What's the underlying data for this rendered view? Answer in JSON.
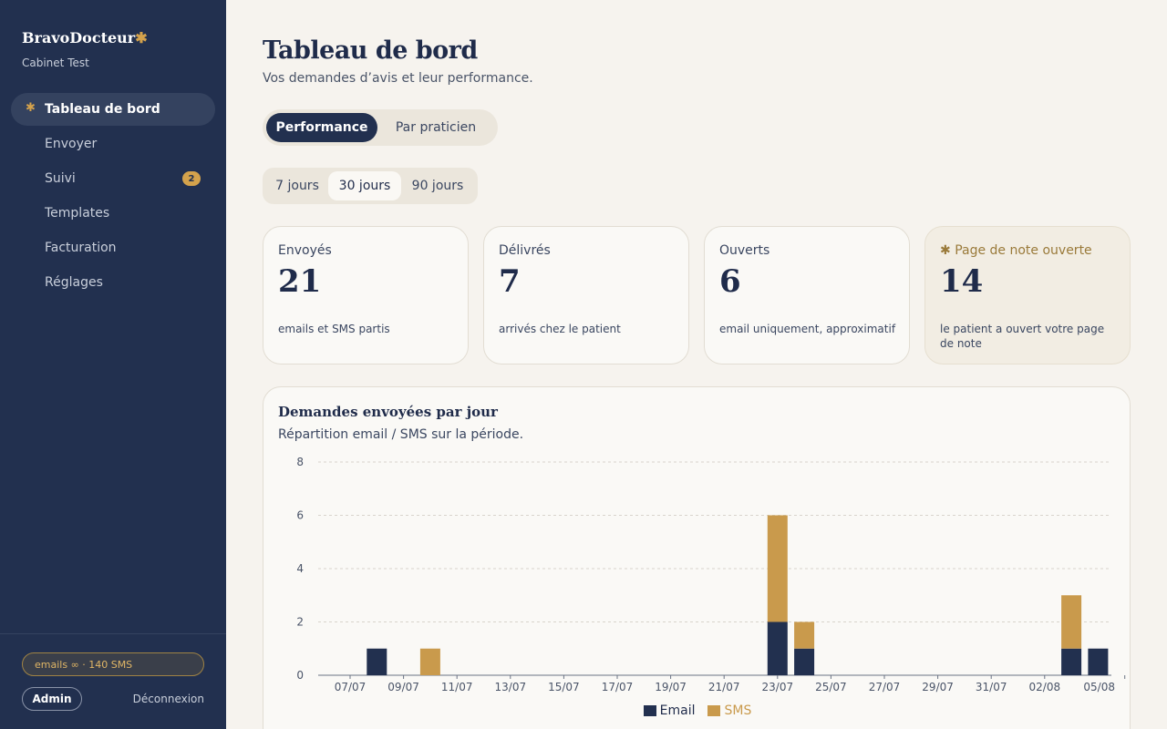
{
  "sidebar": {
    "brand": "BravoDocteur",
    "brand_mark": "✱",
    "cabinet": "Cabinet Test",
    "items": [
      {
        "label": "Tableau de bord",
        "icon": "asterisk-icon",
        "active": true
      },
      {
        "label": "Envoyer"
      },
      {
        "label": "Suivi",
        "badge": "2"
      },
      {
        "label": "Templates"
      },
      {
        "label": "Facturation"
      },
      {
        "label": "Réglages"
      }
    ],
    "quota": "emails ∞ · 140 SMS",
    "admin": "Admin",
    "logout": "Déconnexion"
  },
  "header": {
    "title": "Tableau de bord",
    "subtitle": "Vos demandes d’avis et leur performance."
  },
  "view_tabs": [
    "Performance",
    "Par praticien"
  ],
  "view_selected": "Performance",
  "period_tabs": [
    "7 jours",
    "30 jours",
    "90 jours"
  ],
  "period_selected": "30 jours",
  "kpis": [
    {
      "label": "Envoyés",
      "value": "21",
      "desc": "emails et SMS partis"
    },
    {
      "label": "Délivrés",
      "value": "7",
      "desc": "arrivés chez le patient"
    },
    {
      "label": "Ouverts",
      "value": "6",
      "desc": "email uniquement, approximatif"
    },
    {
      "label": "Page de note ouverte",
      "label_icon": "✱",
      "value": "14",
      "desc": "le patient a ouvert votre page de note",
      "highlight": true
    }
  ],
  "chart": {
    "title": "Demandes envoyées par jour",
    "subtitle": "Répartition email / SMS sur la période."
  },
  "colors": {
    "navy": "#22304f",
    "gold": "#c99a4c",
    "background": "#f6f3ee"
  },
  "chart_data": {
    "type": "bar",
    "stacked": true,
    "categories": [
      "07/07",
      "08/07",
      "09/07",
      "10/07",
      "11/07",
      "12/07",
      "13/07",
      "14/07",
      "15/07",
      "16/07",
      "17/07",
      "18/07",
      "19/07",
      "20/07",
      "21/07",
      "22/07",
      "23/07",
      "24/07",
      "25/07",
      "26/07",
      "27/07",
      "28/07",
      "29/07",
      "30/07",
      "31/07",
      "01/08",
      "02/08",
      "03/08",
      "04/08",
      "05/08"
    ],
    "tick_labels": [
      "07/07",
      "09/07",
      "11/07",
      "13/07",
      "15/07",
      "17/07",
      "19/07",
      "21/07",
      "23/07",
      "25/07",
      "27/07",
      "29/07",
      "31/07",
      "02/08",
      "05/08"
    ],
    "series": [
      {
        "name": "Email",
        "color": "#22304f",
        "values": [
          0,
          1,
          0,
          0,
          0,
          0,
          0,
          0,
          0,
          0,
          0,
          0,
          0,
          0,
          0,
          0,
          2,
          1,
          0,
          0,
          0,
          0,
          0,
          0,
          0,
          0,
          0,
          1,
          1,
          0
        ]
      },
      {
        "name": "SMS",
        "color": "#c99a4c",
        "values": [
          0,
          0,
          0,
          1,
          0,
          0,
          0,
          0,
          0,
          0,
          0,
          0,
          0,
          0,
          0,
          0,
          4,
          1,
          0,
          0,
          0,
          0,
          0,
          0,
          0,
          0,
          0,
          2,
          0,
          0
        ]
      }
    ],
    "yticks": [
      0,
      2,
      4,
      6,
      8
    ],
    "ylim": [
      0,
      8
    ],
    "grid": true,
    "legend": "bottom-center"
  }
}
